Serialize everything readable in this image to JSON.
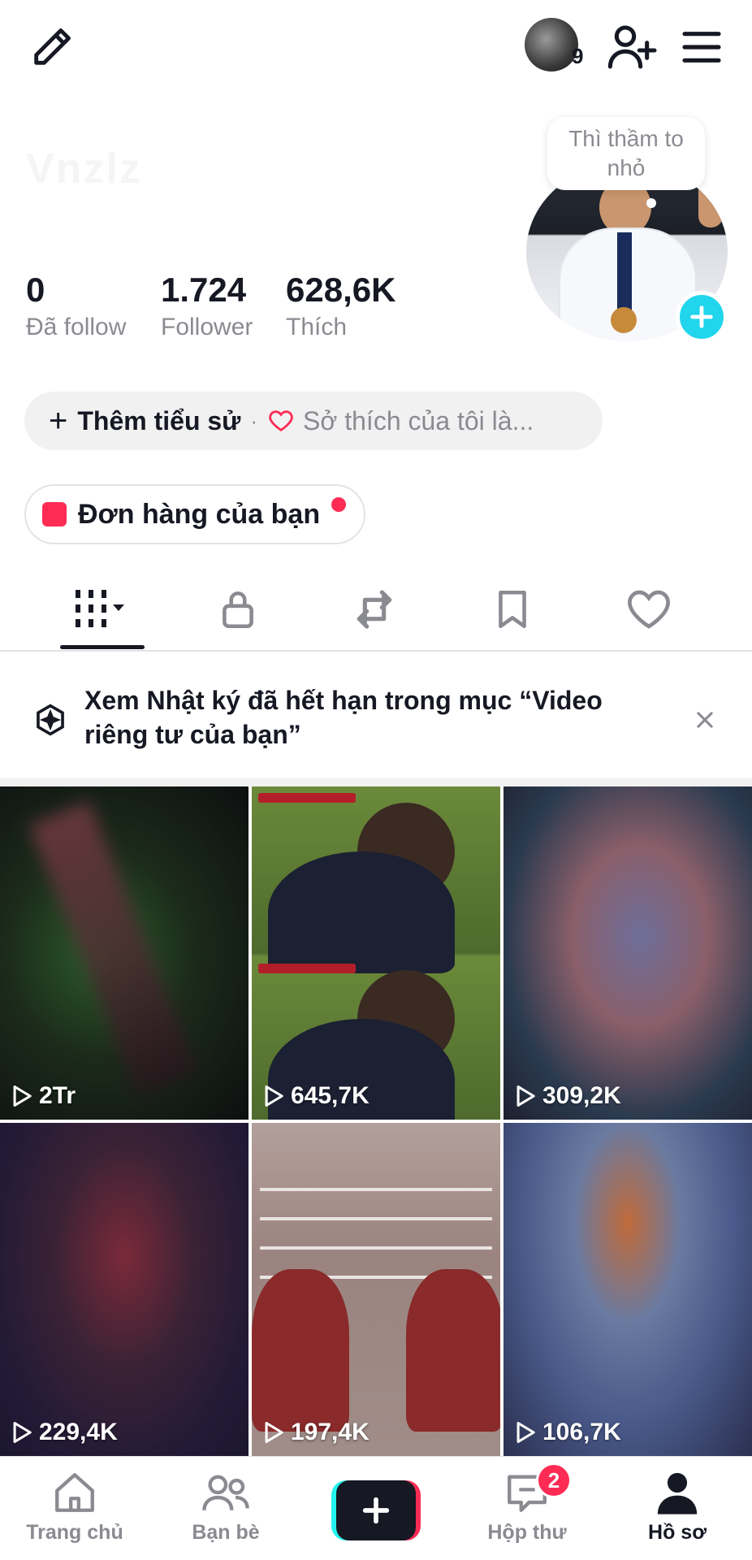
{
  "header": {
    "avatar_badge_count": "9"
  },
  "profile": {
    "username": "Vnzlz",
    "speech_bubble": "Thì thầm to nhỏ",
    "stats": [
      {
        "value": "0",
        "label": "Đã follow"
      },
      {
        "value": "1.724",
        "label": "Follower"
      },
      {
        "value": "628,6K",
        "label": "Thích"
      }
    ],
    "bio": {
      "add_bio": "Thêm tiểu sử",
      "separator": "·",
      "hobby_placeholder": "Sở thích của tôi là..."
    },
    "orders_label": "Đơn hàng của bạn"
  },
  "tabs": [
    {
      "icon": "grid-icon",
      "active": true
    },
    {
      "icon": "lock-icon",
      "active": false
    },
    {
      "icon": "repost-icon",
      "active": false
    },
    {
      "icon": "bookmark-icon",
      "active": false
    },
    {
      "icon": "heart-icon",
      "active": false
    }
  ],
  "notice": {
    "text": "Xem Nhật ký đã hết hạn trong mục “Video riêng tư của bạn”"
  },
  "videos": [
    {
      "views": "2Tr"
    },
    {
      "views": "645,7K"
    },
    {
      "views": "309,2K"
    },
    {
      "views": "229,4K"
    },
    {
      "views": "197,4K"
    },
    {
      "views": "106,7K"
    }
  ],
  "bottom_nav": {
    "home": "Trang chủ",
    "friends": "Bạn bè",
    "inbox": "Hộp thư",
    "inbox_badge": "2",
    "profile": "Hồ sơ"
  },
  "colors": {
    "accent_red": "#fe2c55",
    "accent_cyan": "#20d5ec",
    "text_primary": "#161823",
    "text_secondary": "#8a8b91"
  }
}
